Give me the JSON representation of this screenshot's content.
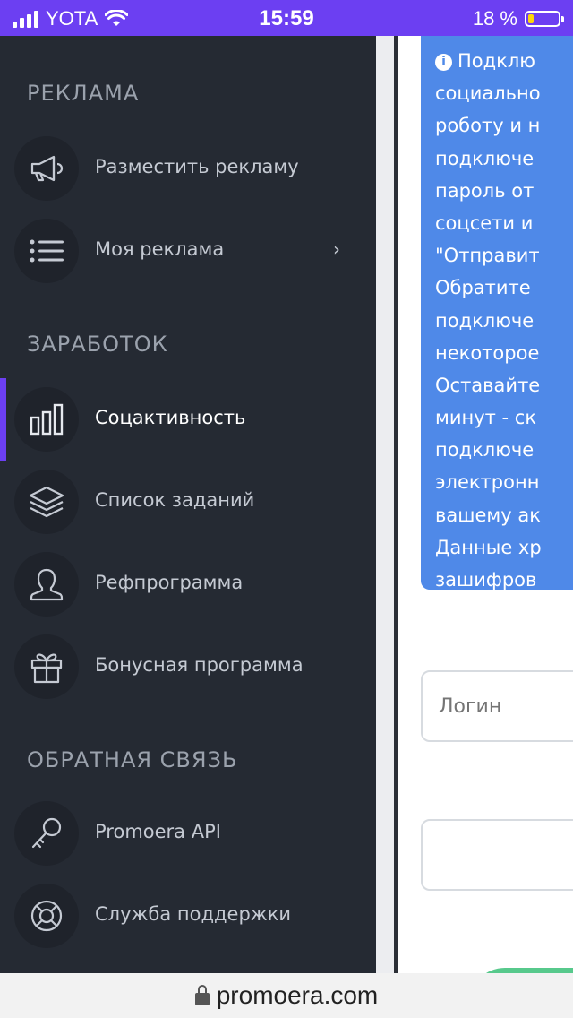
{
  "status_bar": {
    "carrier": "YOTA",
    "time": "15:59",
    "battery_percent": "18 %",
    "battery_level": 0.18,
    "battery_color": "#ffd60a",
    "background": "#6c3ff2"
  },
  "sidebar": {
    "sections": [
      {
        "title": "РЕКЛАМА",
        "items": [
          {
            "label": "Разместить рекламу",
            "icon": "megaphone-icon"
          },
          {
            "label": "Моя реклама",
            "icon": "list-icon",
            "chevron": "›"
          }
        ]
      },
      {
        "title": "ЗАРАБОТОК",
        "items": [
          {
            "label": "Соцактивность",
            "icon": "bar-chart-icon",
            "active": true
          },
          {
            "label": "Список заданий",
            "icon": "layers-icon"
          },
          {
            "label": "Рефпрограмма",
            "icon": "user-icon"
          },
          {
            "label": "Бонусная программа",
            "icon": "gift-icon"
          }
        ]
      },
      {
        "title": "ОБРАТНАЯ СВЯЗЬ",
        "items": [
          {
            "label": "Promoera API",
            "icon": "key-icon"
          },
          {
            "label": "Служба поддержки",
            "icon": "lifebuoy-icon"
          }
        ]
      }
    ],
    "accent_color": "#6c3ff2"
  },
  "main": {
    "info_lines": [
      "Подклю",
      "социально",
      "роботу и н",
      "подключе",
      "пароль от",
      "соцсети и",
      "\"Отправит",
      "Обратите",
      "подключе",
      "некоторое",
      "Оставайте",
      "минут - ск",
      "подключе",
      "электронн",
      "вашему ак",
      "Данные хр",
      "зашифров"
    ],
    "info_color": "#4f89e8",
    "login_placeholder": "Логин",
    "password_placeholder": ""
  },
  "url_bar": {
    "domain": "promoera.com"
  }
}
